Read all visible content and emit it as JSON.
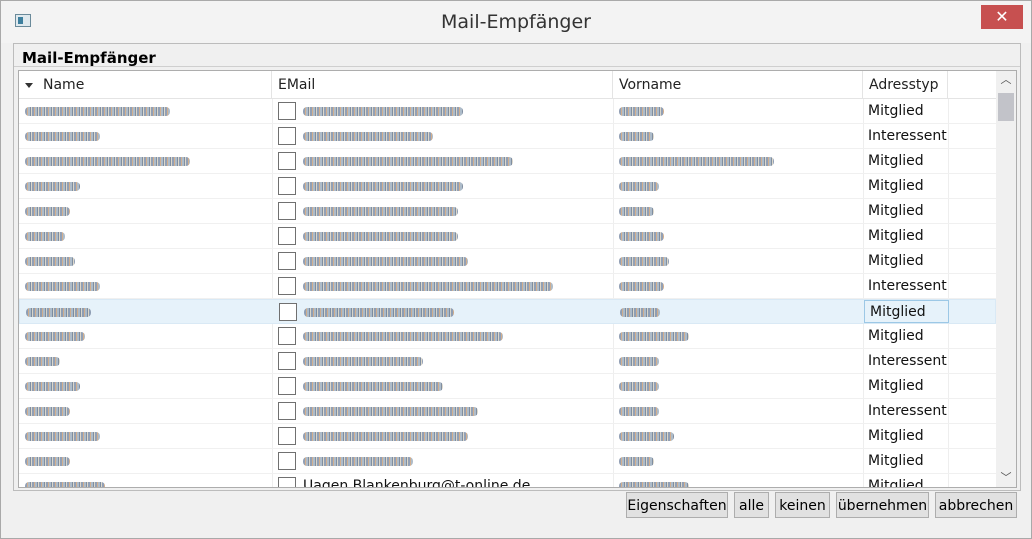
{
  "window": {
    "title": "Mail-Empfänger",
    "close_glyph": "✕"
  },
  "group": {
    "title": "Mail-Empfänger"
  },
  "table": {
    "columns": [
      "Name",
      "EMail",
      "Vorname",
      "Adresstyp"
    ],
    "rows": [
      {
        "adresstyp": "Mitglied",
        "checked": false
      },
      {
        "adresstyp": "Interessent",
        "checked": false
      },
      {
        "adresstyp": "Mitglied",
        "checked": false
      },
      {
        "adresstyp": "Mitglied",
        "checked": false
      },
      {
        "adresstyp": "Mitglied",
        "checked": false
      },
      {
        "adresstyp": "Mitglied",
        "checked": false
      },
      {
        "adresstyp": "Mitglied",
        "checked": false
      },
      {
        "adresstyp": "Interessent",
        "checked": false
      },
      {
        "adresstyp": "Mitglied",
        "checked": false,
        "selected": true
      },
      {
        "adresstyp": "Mitglied",
        "checked": false
      },
      {
        "adresstyp": "Interessent",
        "checked": false
      },
      {
        "adresstyp": "Mitglied",
        "checked": false
      },
      {
        "adresstyp": "Interessent",
        "checked": false
      },
      {
        "adresstyp": "Mitglied",
        "checked": false
      },
      {
        "adresstyp": "Mitglied",
        "checked": false
      },
      {
        "adresstyp": "Mitglied",
        "checked": false,
        "partial": true
      }
    ],
    "partial_row_email": "Uagen.Blankenburg@t-online.de"
  },
  "buttons": {
    "eigenschaften": "Eigenschaften",
    "alle": "alle",
    "keinen": "keinen",
    "uebernehmen": "übernehmen",
    "abbrechen": "abbrechen"
  },
  "icons": {
    "sort": "sort-descending-icon",
    "scroll_up": "chevron-up-icon",
    "scroll_down": "chevron-down-icon",
    "app": "window-app-icon",
    "close": "close-icon"
  },
  "colors": {
    "close_button": "#c75050",
    "selected_row": "#e6f2fa"
  }
}
